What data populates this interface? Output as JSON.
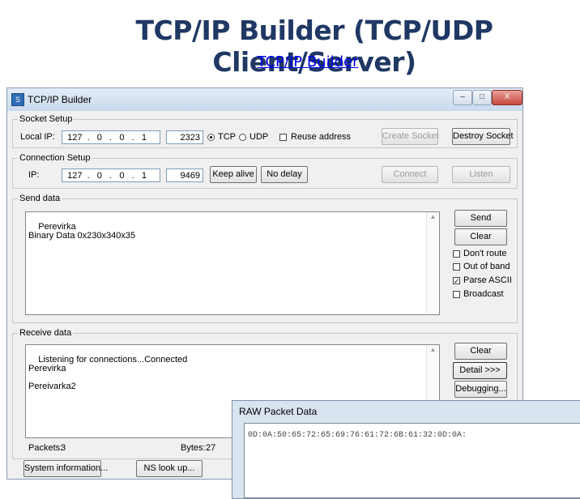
{
  "page": {
    "title": "TCP/IP Builder (TCP/UDP Client/Server)",
    "link": "TCP/IP Builder"
  },
  "window": {
    "title": "TCP/IP Builder",
    "app_icon": "S",
    "minimize": "–",
    "maximize": "□",
    "close": "X"
  },
  "socket_setup": {
    "legend": "Socket Setup",
    "local_ip_label": "Local IP:",
    "ip": "  127  .   0   .   0   .   1",
    "port": "2323",
    "tcp_label": "TCP",
    "udp_label": "UDP",
    "tcp_selected": true,
    "reuse_label": "Reuse address",
    "reuse_checked": false,
    "create_socket": "Create Socket",
    "destroy_socket": "Destroy Socket"
  },
  "connection_setup": {
    "legend": "Connection Setup",
    "ip_label": "IP:",
    "ip": "  127  .   0   .   0   .   1",
    "port": "9469",
    "keep_alive": "Keep alive",
    "no_delay": "No delay",
    "connect": "Connect",
    "listen": "Listen"
  },
  "send_data": {
    "legend": "Send data",
    "text": "Perevirka\nBinary Data 0x230x340x35",
    "send": "Send",
    "clear": "Clear",
    "options": [
      {
        "label": "Don't route",
        "checked": false
      },
      {
        "label": "Out of band",
        "checked": false
      },
      {
        "label": "Parse ASCII",
        "checked": true
      },
      {
        "label": "Broadcast",
        "checked": false
      }
    ]
  },
  "receive_data": {
    "legend": "Receive data",
    "text": "Listening for connections...Connected\nPerevirka\n\nPereivarka2",
    "clear": "Clear",
    "detail": "Detail >>>",
    "debugging": "Debugging...",
    "packets_label": "Packets:",
    "packets_value": "3",
    "bytes_label": "Bytes:",
    "bytes_value": "27"
  },
  "bottom": {
    "system_info": "System information...",
    "ns_lookup": "NS look up..."
  },
  "raw_packet": {
    "title": "RAW Packet Data",
    "data": "0D:0A:50:65:72:65:69:76:61:72:6B:61:32:0D:0A:"
  }
}
